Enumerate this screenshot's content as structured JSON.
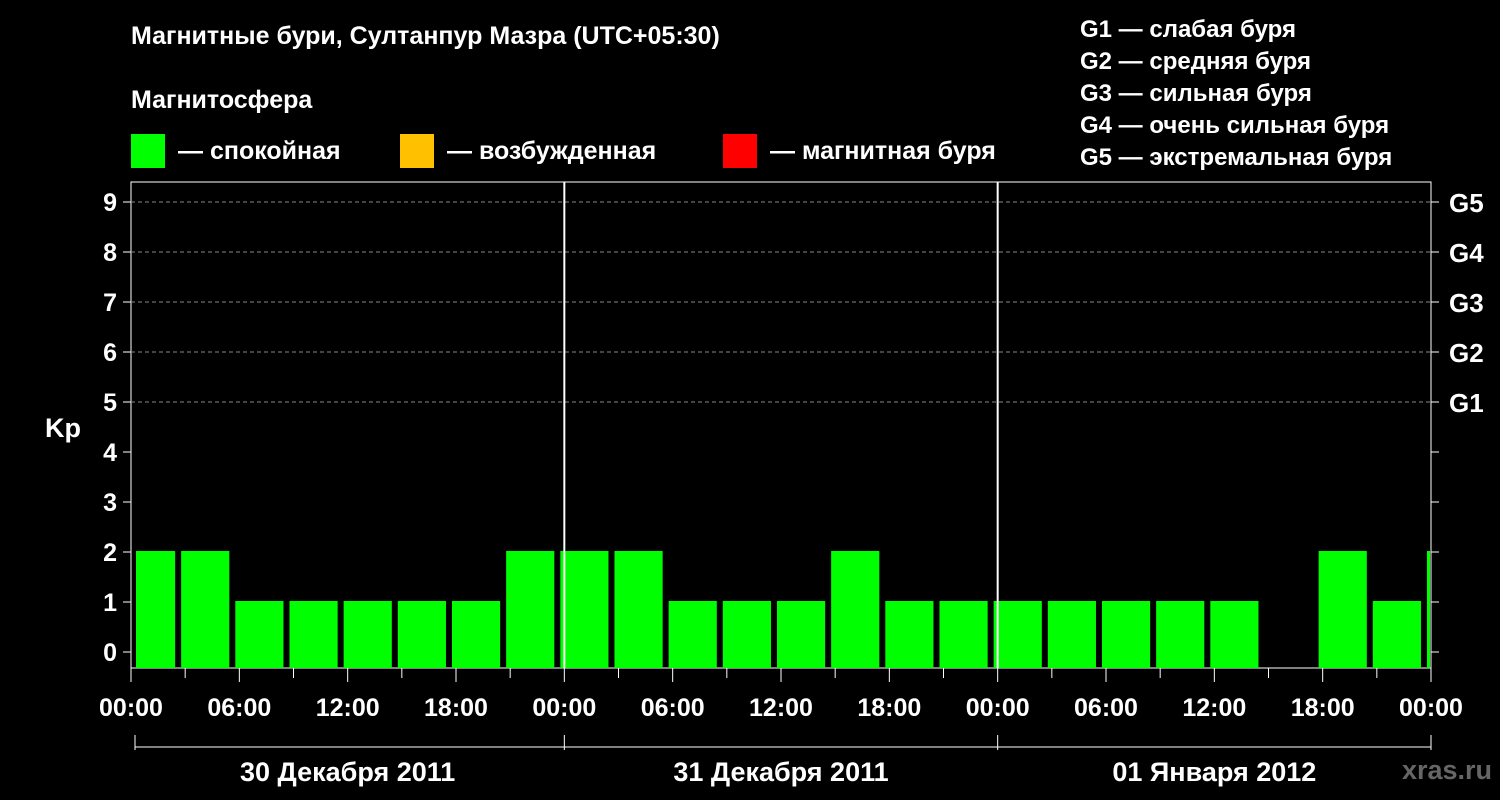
{
  "title": "Магнитные бури, Султанпур Мазра (UTC+05:30)",
  "subtitle": "Магнитосфера",
  "legend": [
    {
      "color": "#00ff00",
      "label": "— спокойная"
    },
    {
      "color": "#ffc000",
      "label": "— возбужденная"
    },
    {
      "color": "#ff0000",
      "label": "— магнитная буря"
    }
  ],
  "g_legend": [
    "G1 — слабая буря",
    "G2 — средняя буря",
    "G3 — сильная буря",
    "G4 — очень сильная буря",
    "G5 — экстремальная буря"
  ],
  "watermark": "xras.ru",
  "chart_data": {
    "type": "bar",
    "ylabel": "Kp",
    "ylim": [
      0,
      9
    ],
    "y_ticks": [
      0,
      1,
      2,
      3,
      4,
      5,
      6,
      7,
      8,
      9
    ],
    "right_axis_labels": [
      {
        "kp": 5,
        "label": "G1"
      },
      {
        "kp": 6,
        "label": "G2"
      },
      {
        "kp": 7,
        "label": "G3"
      },
      {
        "kp": 8,
        "label": "G4"
      },
      {
        "kp": 9,
        "label": "G5"
      }
    ],
    "x_start": "2011-12-30 00:00",
    "x_end": "2012-01-02 00:00",
    "x_tick_labels": [
      "00:00",
      "06:00",
      "12:00",
      "18:00",
      "00:00",
      "06:00",
      "12:00",
      "18:00",
      "00:00",
      "06:00",
      "12:00",
      "18:00",
      "00:00"
    ],
    "day_labels": [
      "30 Декабря 2011",
      "31 Декабря 2011",
      "01 Января 2012"
    ],
    "grid": "horizontal dashed at each Kp level",
    "bar_color": "#00ff00",
    "bars": [
      {
        "start": "2011-12-30 00:00",
        "end": "2011-12-30 02:30",
        "kp": 2
      },
      {
        "start": "2011-12-30 02:30",
        "end": "2011-12-30 05:30",
        "kp": 2
      },
      {
        "start": "2011-12-30 05:30",
        "end": "2011-12-30 08:30",
        "kp": 1
      },
      {
        "start": "2011-12-30 08:30",
        "end": "2011-12-30 11:30",
        "kp": 1
      },
      {
        "start": "2011-12-30 11:30",
        "end": "2011-12-30 14:30",
        "kp": 1
      },
      {
        "start": "2011-12-30 14:30",
        "end": "2011-12-30 17:30",
        "kp": 1
      },
      {
        "start": "2011-12-30 17:30",
        "end": "2011-12-30 20:30",
        "kp": 1
      },
      {
        "start": "2011-12-30 20:30",
        "end": "2011-12-30 23:30",
        "kp": 2
      },
      {
        "start": "2011-12-30 23:30",
        "end": "2011-12-31 02:30",
        "kp": 2
      },
      {
        "start": "2011-12-31 02:30",
        "end": "2011-12-31 05:30",
        "kp": 2
      },
      {
        "start": "2011-12-31 05:30",
        "end": "2011-12-31 08:30",
        "kp": 1
      },
      {
        "start": "2011-12-31 08:30",
        "end": "2011-12-31 11:30",
        "kp": 1
      },
      {
        "start": "2011-12-31 11:30",
        "end": "2011-12-31 14:30",
        "kp": 1
      },
      {
        "start": "2011-12-31 14:30",
        "end": "2011-12-31 17:30",
        "kp": 2
      },
      {
        "start": "2011-12-31 17:30",
        "end": "2011-12-31 20:30",
        "kp": 1
      },
      {
        "start": "2011-12-31 20:30",
        "end": "2011-12-31 23:30",
        "kp": 1
      },
      {
        "start": "2011-12-31 23:30",
        "end": "2012-01-01 02:30",
        "kp": 1
      },
      {
        "start": "2012-01-01 02:30",
        "end": "2012-01-01 05:30",
        "kp": 1
      },
      {
        "start": "2012-01-01 05:30",
        "end": "2012-01-01 08:30",
        "kp": 1
      },
      {
        "start": "2012-01-01 08:30",
        "end": "2012-01-01 11:30",
        "kp": 1
      },
      {
        "start": "2012-01-01 11:30",
        "end": "2012-01-01 14:30",
        "kp": 1
      },
      {
        "start": "2012-01-01 17:30",
        "end": "2012-01-01 20:30",
        "kp": 2
      },
      {
        "start": "2012-01-01 20:30",
        "end": "2012-01-01 23:30",
        "kp": 1
      },
      {
        "start": "2012-01-01 23:30",
        "end": "2012-01-02 00:00",
        "kp": 2
      }
    ]
  }
}
